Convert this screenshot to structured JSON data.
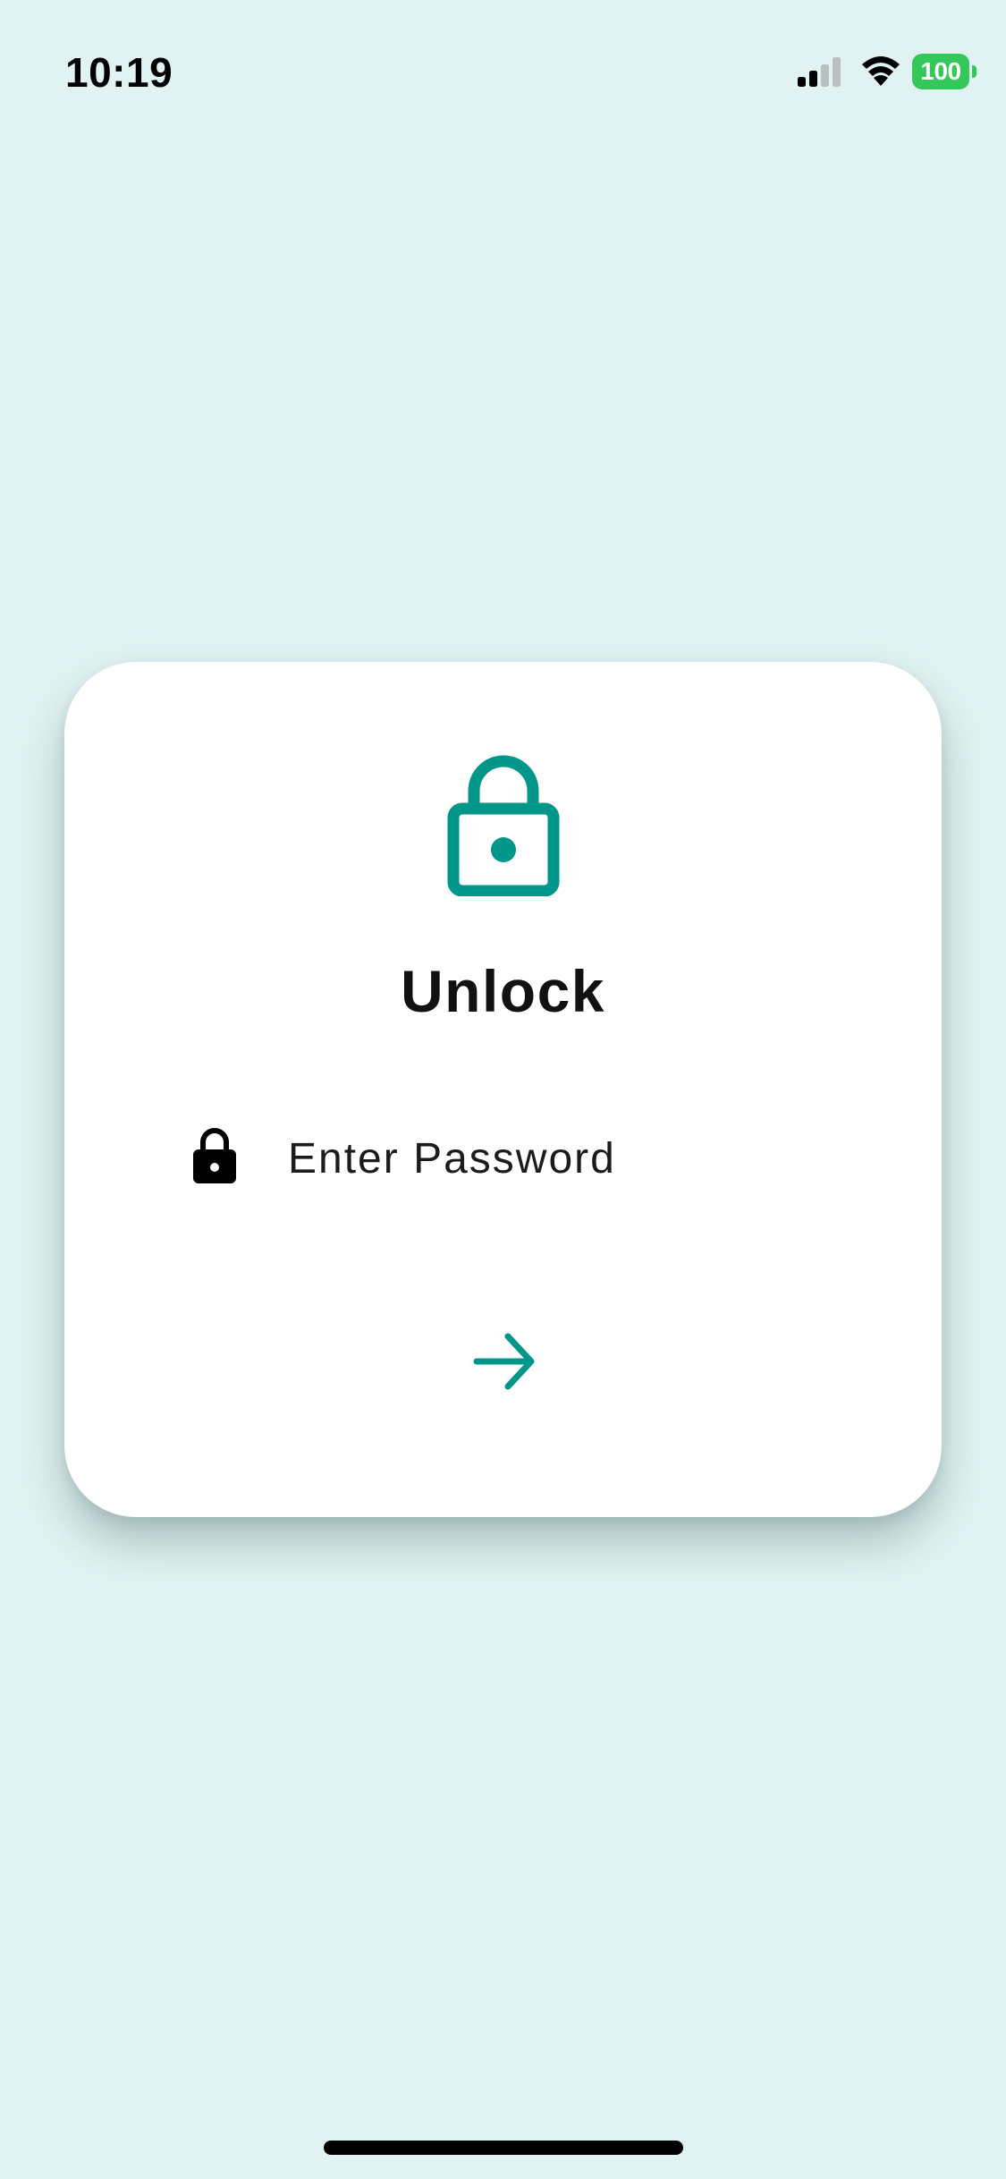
{
  "status_bar": {
    "time": "10:19",
    "battery_level": "100",
    "battery_color": "#34c759",
    "signal_bars_active": 2,
    "signal_bars_total": 4,
    "icons": [
      "signal-icon",
      "wifi-icon",
      "battery-icon"
    ]
  },
  "card": {
    "hero_icon": "lock-icon",
    "title": "Unlock",
    "password_field": {
      "icon": "lock-icon",
      "placeholder": "Enter Password",
      "value": ""
    },
    "submit_icon": "arrow-right-icon"
  },
  "colors": {
    "background": "#e0f2f1",
    "accent": "#00968a",
    "card": "#ffffff"
  }
}
